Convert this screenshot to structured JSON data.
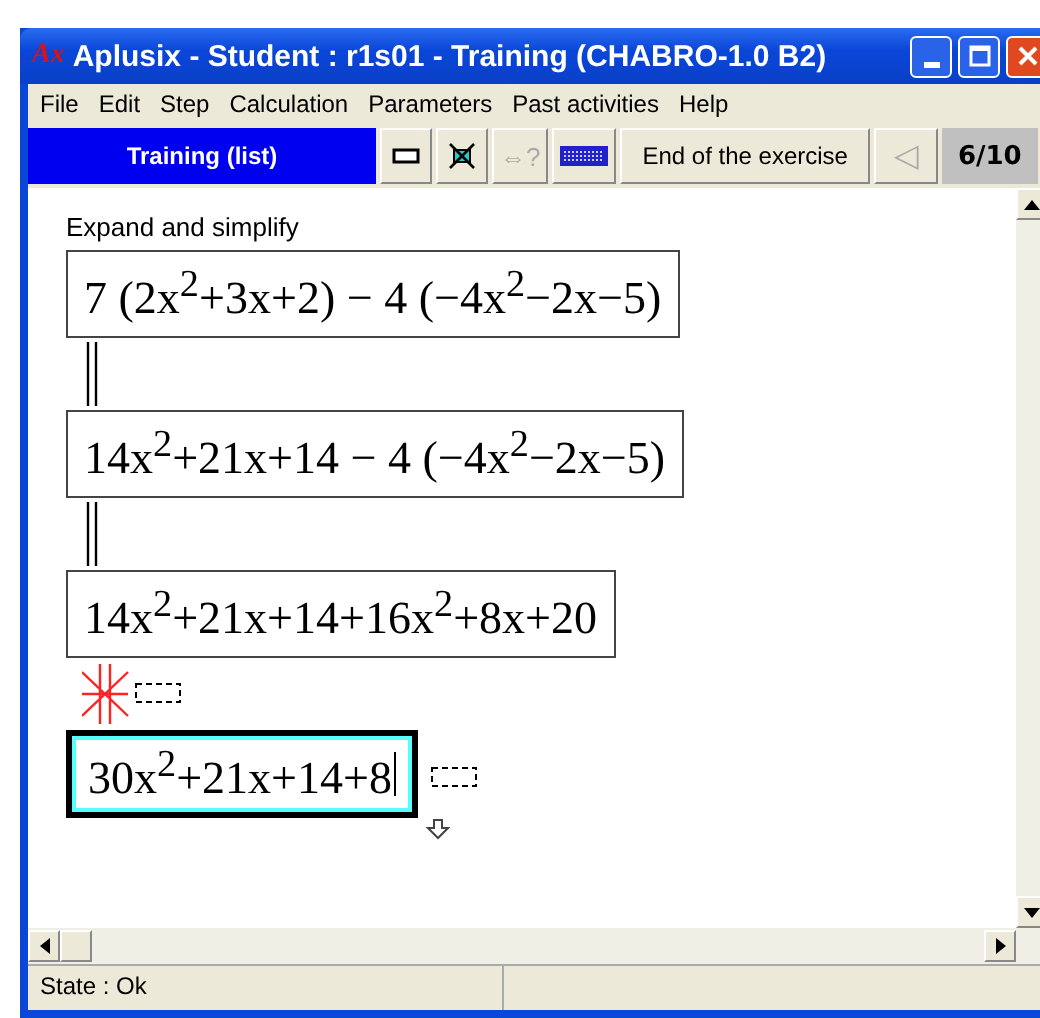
{
  "window": {
    "logo": "Ax",
    "title": "Aplusix - Student : r1s01 - Training (CHABRO-1.0 B2)"
  },
  "menu": [
    "File",
    "Edit",
    "Step",
    "Calculation",
    "Parameters",
    "Past activities",
    "Help"
  ],
  "toolbar": {
    "mode": "Training (list)",
    "tools": [
      {
        "kind": "rectangle",
        "disabled": false
      },
      {
        "kind": "cross",
        "disabled": false
      },
      {
        "kind": "equivalence",
        "label": "⇔?",
        "disabled": true
      },
      {
        "kind": "keyboard",
        "disabled": false
      }
    ],
    "end_button": "End of the exercise",
    "prev": {
      "label": "◁",
      "disabled": true
    },
    "counter": "6/10"
  },
  "instruction": "Expand and simplify",
  "steps": [
    {
      "kind": "first",
      "expression": "7 (2x$^{2}$+3x+2) − 4 (−4x$^{2}$−2x−5)",
      "active": false
    },
    {
      "kind": "equivalent",
      "expression": "14x$^{2}$+21x+14 − 4 (−4x$^{2}$−2x−5)",
      "active": false
    },
    {
      "kind": "equivalent",
      "expression": "14x$^{2}$+21x+14+16x$^{2}$+8x+20",
      "active": false
    },
    {
      "kind": "not_equivalent",
      "expression": "30x$^{2}$+21x+14+8",
      "active": true
    }
  ],
  "status_bar": {
    "state": "State : Ok"
  }
}
